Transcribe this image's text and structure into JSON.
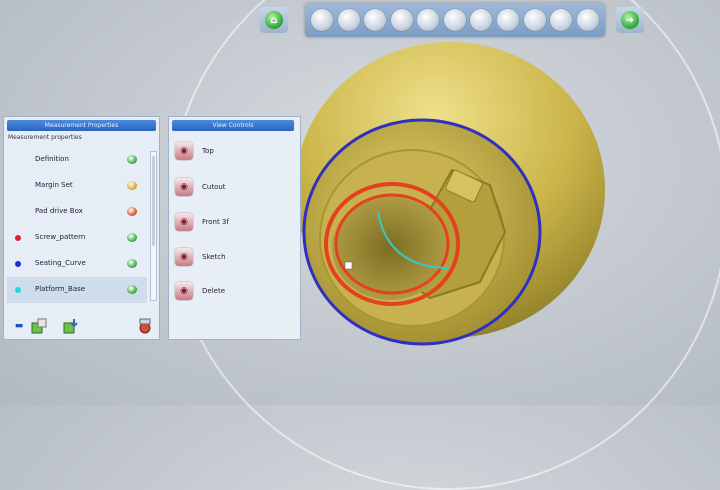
{
  "toolbar": {
    "tools": [
      {
        "name": "render-icon"
      },
      {
        "name": "shade-icon"
      },
      {
        "name": "phone-icon"
      },
      {
        "name": "pan-icon"
      },
      {
        "name": "point-icon"
      },
      {
        "name": "rotate-icon"
      },
      {
        "name": "zoom-icon"
      },
      {
        "name": "fit-icon"
      },
      {
        "name": "section-icon"
      },
      {
        "name": "measure-icon"
      },
      {
        "name": "markup-icon"
      }
    ]
  },
  "left_panel": {
    "title": "Measurement Properties",
    "subtitle": "Measurement properties",
    "layers": [
      {
        "label": "Definition",
        "marker": "",
        "vis": "#27a535"
      },
      {
        "label": "Margin Set",
        "marker": "",
        "vis": "#d2a01a"
      },
      {
        "label": "Pad drive Box",
        "marker": "",
        "vis": "#d14a1d"
      },
      {
        "label": "Screw_pattern",
        "marker": "#e0212b",
        "vis": "#27a535"
      },
      {
        "label": "Seating_Curve",
        "marker": "#1a2ec9",
        "vis": "#27a535"
      },
      {
        "label": "Platform_Base",
        "marker": "#2ad6e6",
        "vis": "#27a535"
      }
    ]
  },
  "right_panel": {
    "title": "View Controls",
    "views": [
      {
        "label": "Top"
      },
      {
        "label": "Cutout"
      },
      {
        "label": "Front 3f"
      },
      {
        "label": "Sketch"
      },
      {
        "label": "Delete"
      }
    ]
  },
  "colors": {
    "part_yellow": "#c9b343",
    "blue_edge": "#2f2fc0",
    "red_edge": "#e2431e",
    "cyan_edge": "#37c9c9"
  }
}
